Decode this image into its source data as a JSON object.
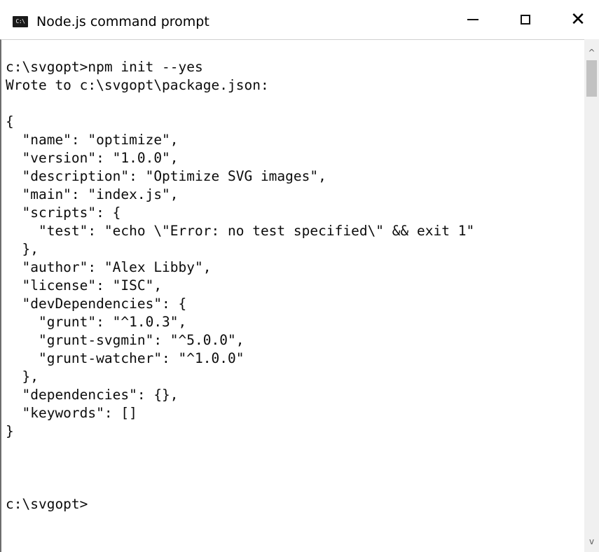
{
  "window": {
    "title": "Node.js command prompt",
    "icon_label": "C:\\",
    "controls": {
      "minimize_icon": "minimize-icon",
      "maximize_icon": "maximize-icon",
      "close_icon": "close-icon",
      "close_glyph": "✕"
    }
  },
  "console": {
    "lines": [
      "c:\\svgopt>npm init --yes",
      "Wrote to c:\\svgopt\\package.json:",
      "",
      "{",
      "  \"name\": \"optimize\",",
      "  \"version\": \"1.0.0\",",
      "  \"description\": \"Optimize SVG images\",",
      "  \"main\": \"index.js\",",
      "  \"scripts\": {",
      "    \"test\": \"echo \\\"Error: no test specified\\\" && exit 1\"",
      "  },",
      "  \"author\": \"Alex Libby\",",
      "  \"license\": \"ISC\",",
      "  \"devDependencies\": {",
      "    \"grunt\": \"^1.0.3\",",
      "    \"grunt-svgmin\": \"^5.0.0\",",
      "    \"grunt-watcher\": \"^1.0.0\"",
      "  },",
      "  \"dependencies\": {},",
      "  \"keywords\": []",
      "}",
      "",
      "",
      "",
      "c:\\svgopt>"
    ]
  },
  "scrollbar": {
    "up_glyph": "^",
    "down_glyph": "v",
    "thumb_position_fraction": 0.0
  },
  "colors": {
    "background": "#ffffff",
    "text": "#0c0c0c",
    "scrollbar_track": "#f0f0f0",
    "scrollbar_thumb": "#c2c2c2"
  }
}
